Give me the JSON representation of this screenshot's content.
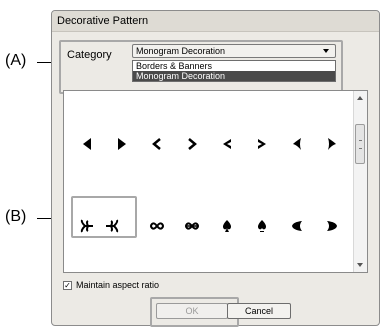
{
  "callouts": {
    "a": "(A)",
    "b": "(B)"
  },
  "dialog": {
    "title": "Decorative Pattern",
    "category": {
      "label": "Category",
      "selected": "Monogram Decoration",
      "options": [
        "Borders & Banners",
        "Monogram Decoration"
      ]
    },
    "patterns": {
      "row1": [
        "triangle-left",
        "triangle-right",
        "chevron-left",
        "chevron-right",
        "notched-left",
        "notched-right",
        "swoosh-left",
        "swoosh-right"
      ],
      "row2": [
        "fleur-left",
        "fleur-right",
        "infinity",
        "infinity-alt",
        "spade",
        "spade-alt",
        "leaf-left",
        "leaf-right"
      ]
    },
    "maintain_aspect_ratio": {
      "label": "Maintain aspect ratio",
      "checked": true
    },
    "buttons": {
      "ok": "OK",
      "cancel": "Cancel"
    }
  }
}
